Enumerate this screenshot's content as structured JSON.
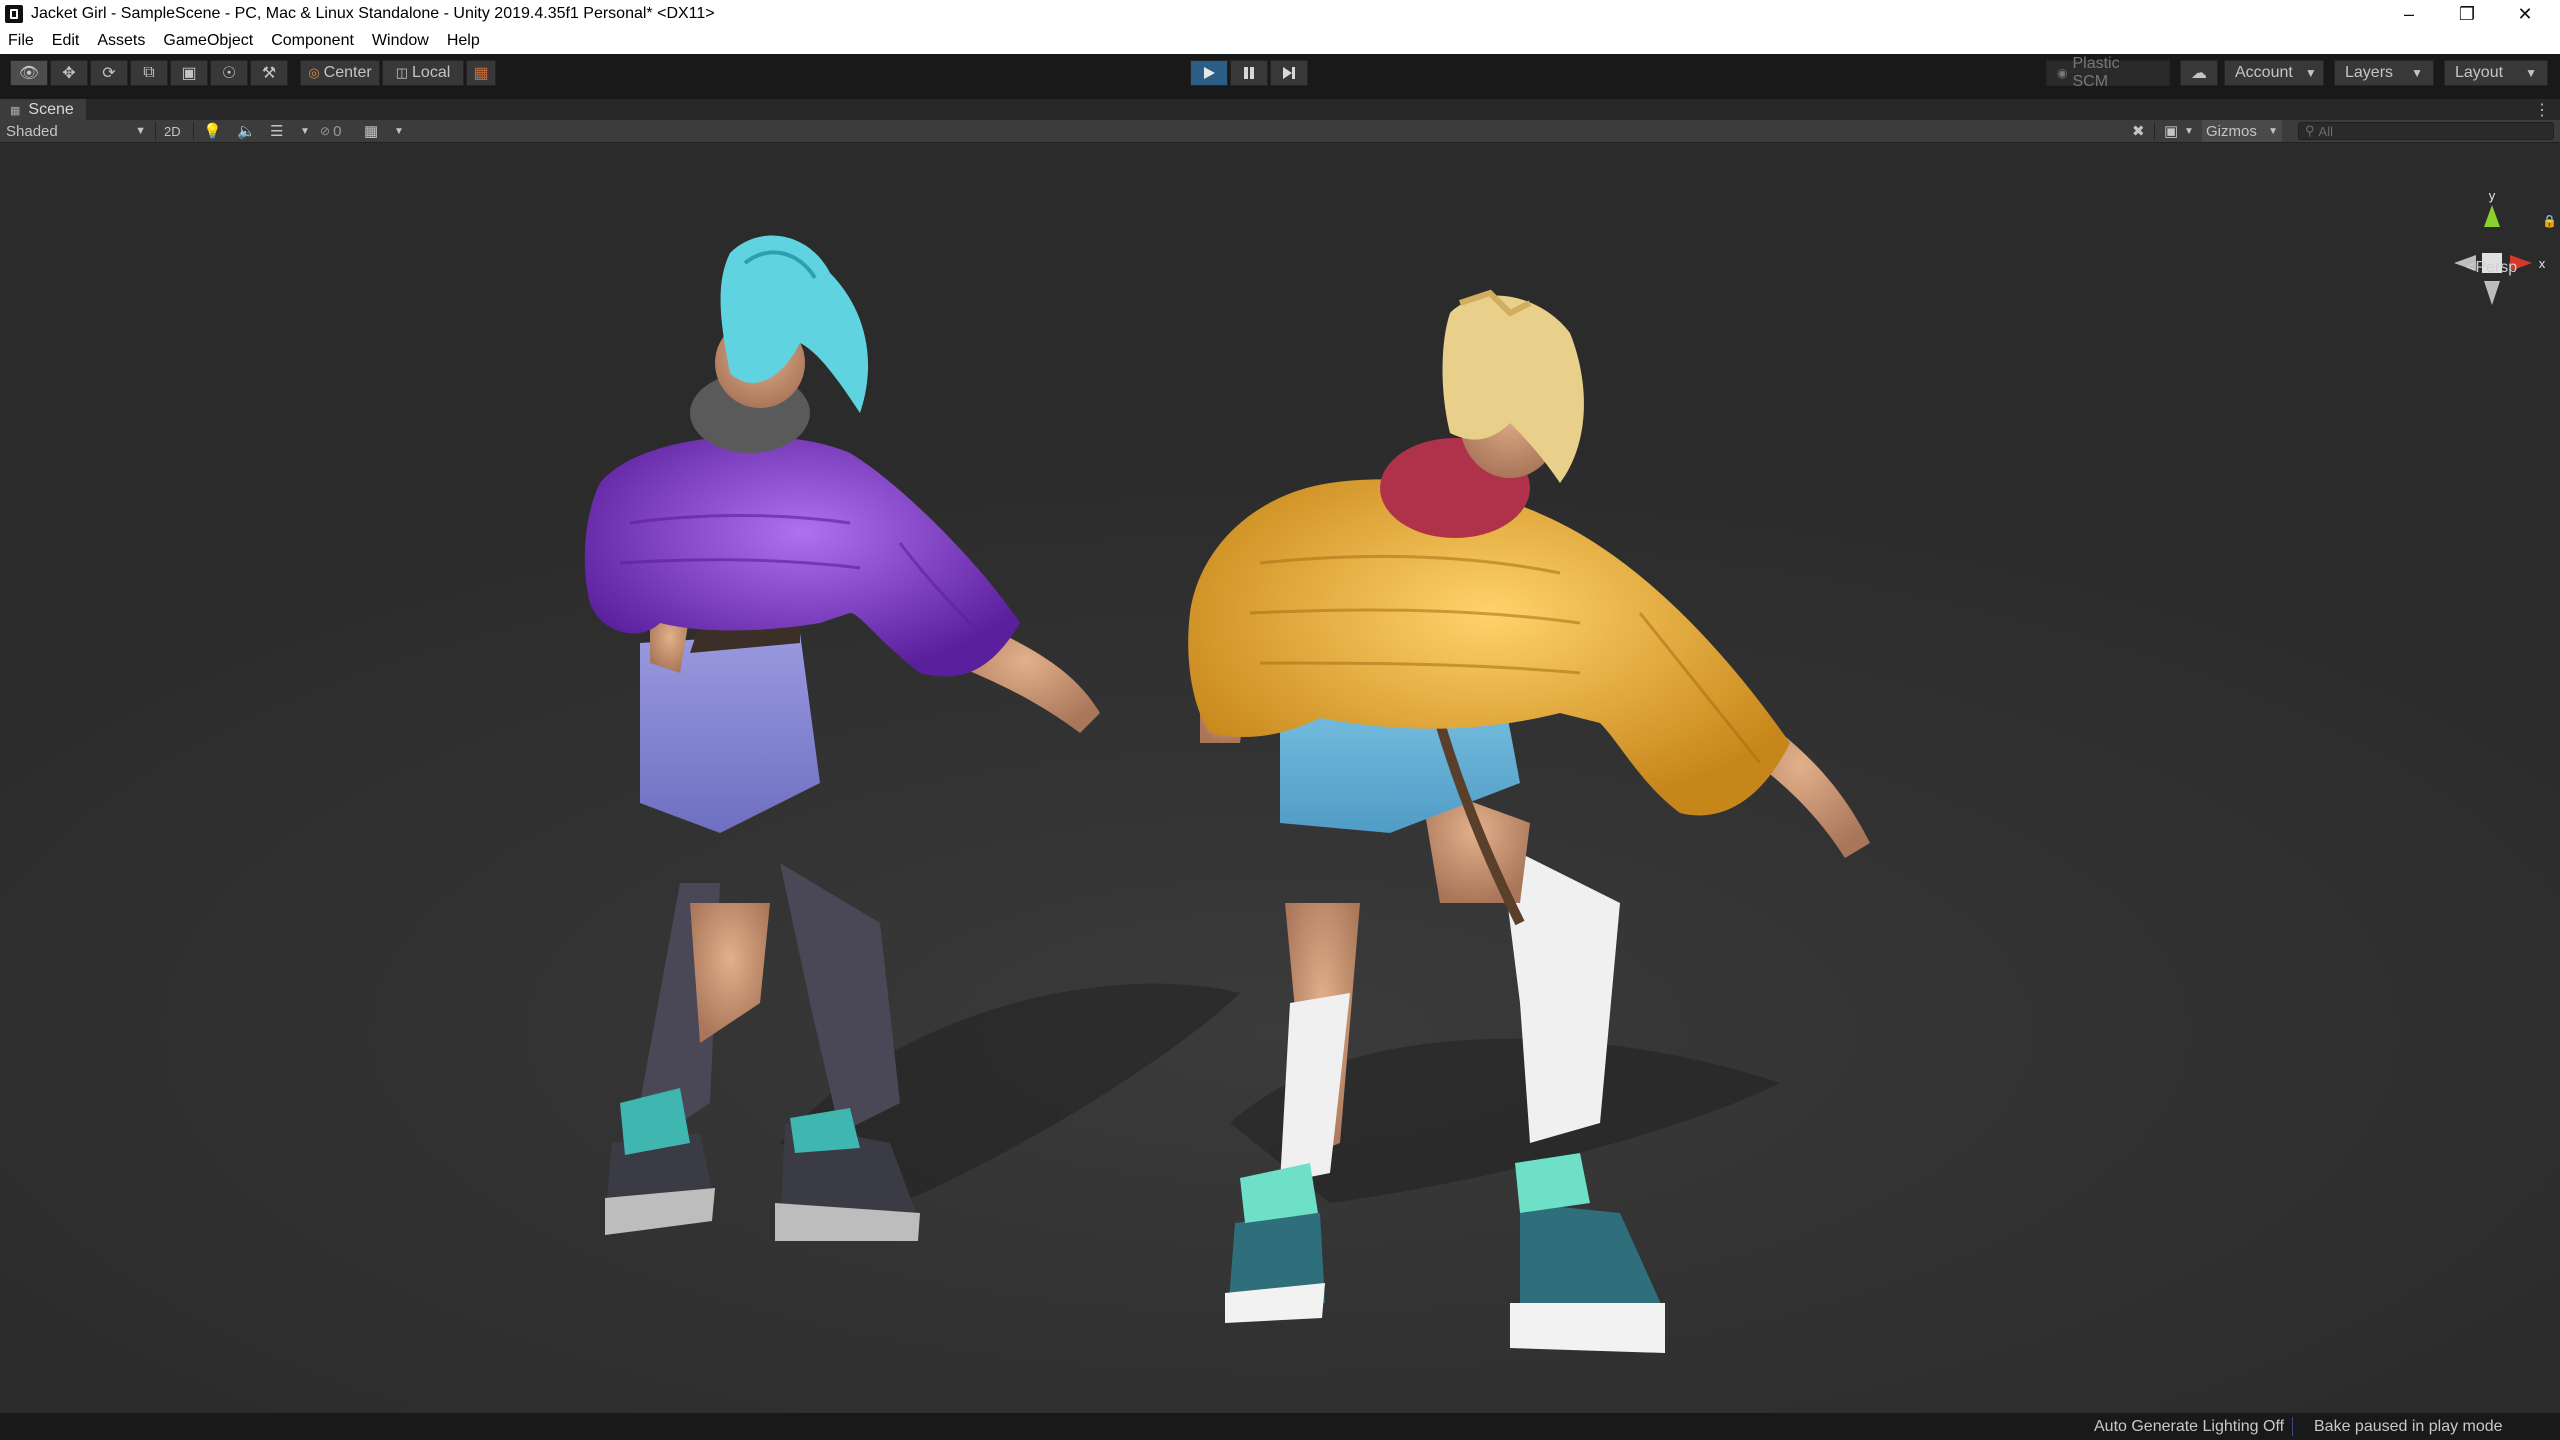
{
  "window": {
    "title": "Jacket Girl - SampleScene - PC, Mac & Linux Standalone - Unity 2019.4.35f1 Personal* <DX11>"
  },
  "menu": [
    "File",
    "Edit",
    "Assets",
    "GameObject",
    "Component",
    "Window",
    "Help"
  ],
  "toolbar": {
    "pivot_mode": "Center",
    "pivot_rotation": "Local",
    "plastic_scm": "Plastic SCM",
    "account": "Account",
    "layers": "Layers",
    "layout": "Layout"
  },
  "scene": {
    "tab_label": "Scene",
    "draw_mode": "Shaded",
    "two_d": "2D",
    "hidden_count": "0",
    "gizmos": "Gizmos",
    "search_placeholder": "All",
    "projection": "Persp",
    "axis_y": "y",
    "axis_x": "x"
  },
  "status": {
    "lighting": "Auto Generate Lighting Off",
    "bake": "Bake paused in play mode"
  },
  "colors": {
    "play_active": "#2c5d87",
    "jacket_purple": "#8a3fd0",
    "jacket_yellow": "#e8a92a",
    "gizmo_y": "#8ad12f",
    "gizmo_x": "#d33a2c"
  }
}
